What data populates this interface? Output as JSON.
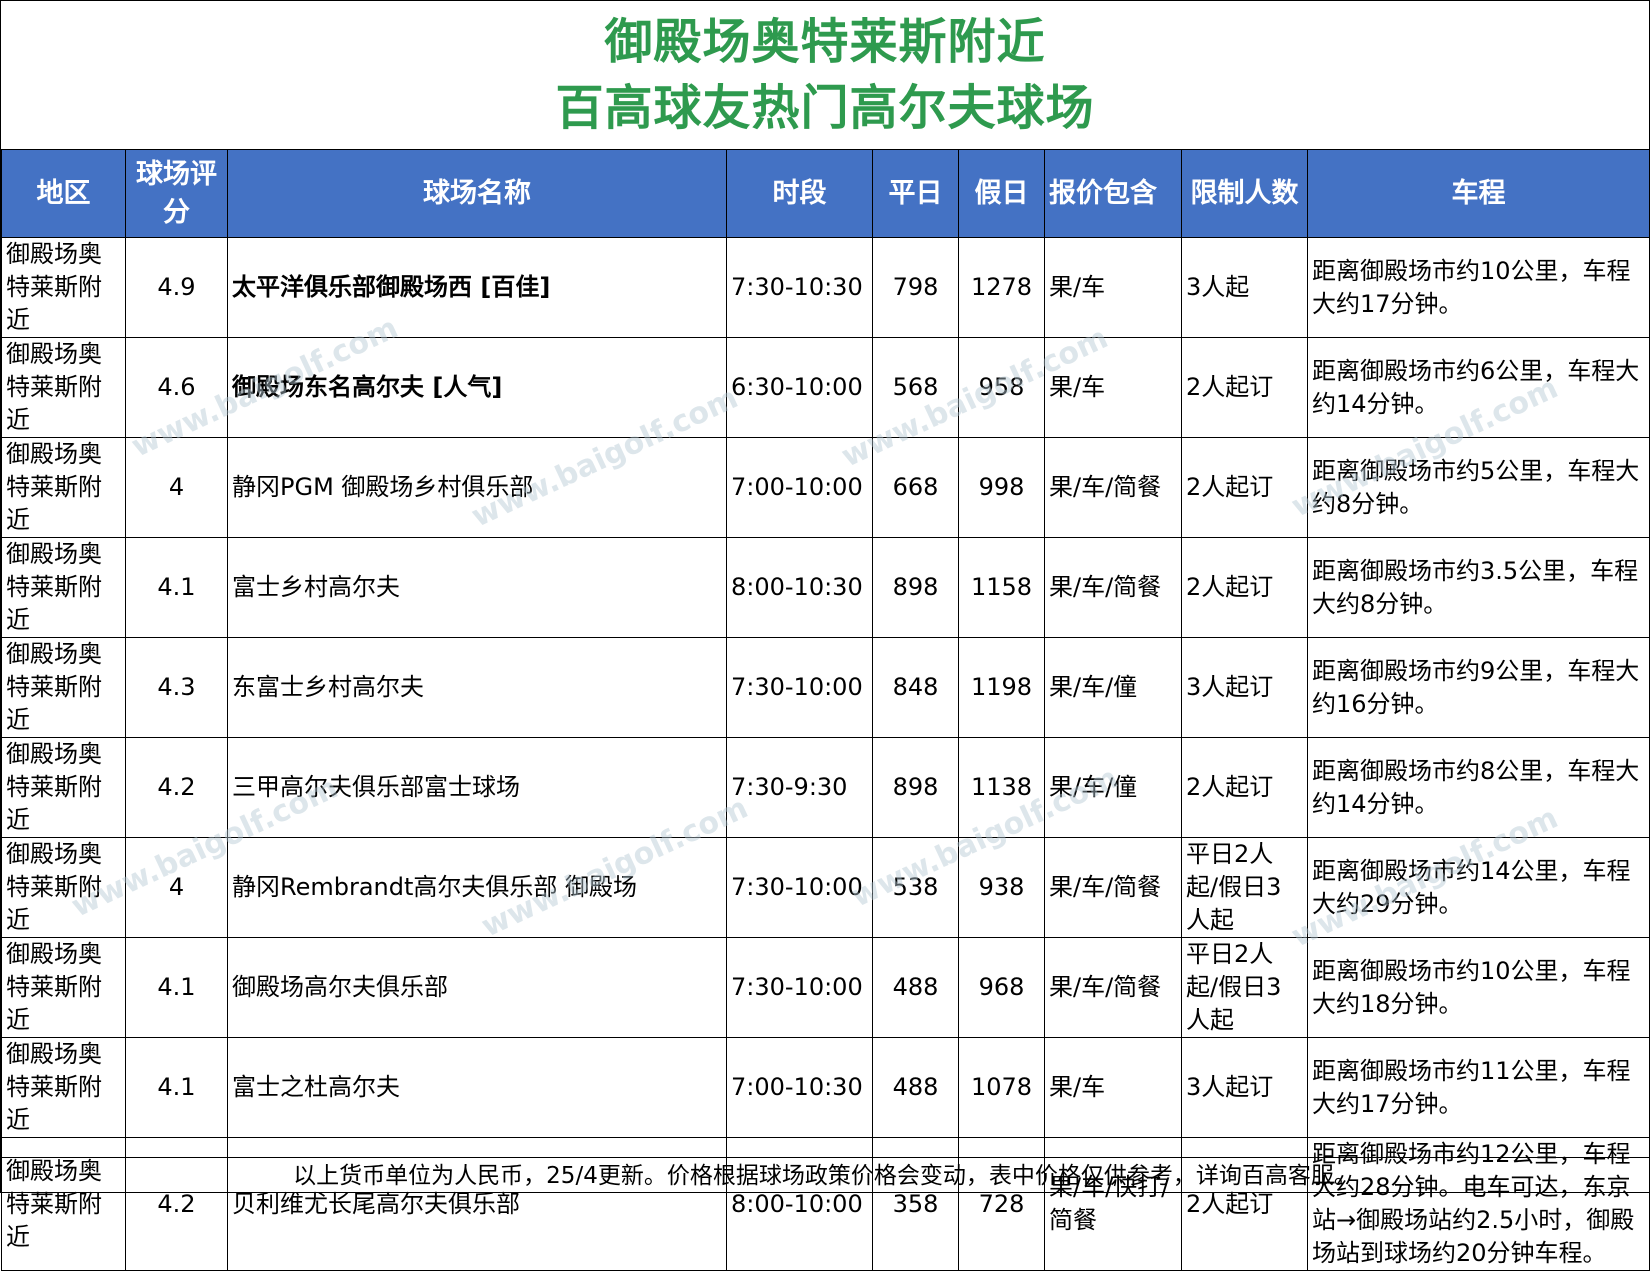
{
  "title": {
    "line1": "御殿场奥特莱斯附近",
    "line2": "百高球友热门高尔夫球场"
  },
  "headers": {
    "region": "地区",
    "rating": "球场评分",
    "name": "球场名称",
    "time": "时段",
    "weekday": "平日",
    "holiday": "假日",
    "includes": "报价包含",
    "limit": "限制人数",
    "drive": "车程"
  },
  "rows": [
    {
      "region": "御殿场奥特莱斯附近",
      "rating": "4.9",
      "name": "太平洋俱乐部御殿场西 [百佳]",
      "bold": true,
      "time": "7:30-10:30",
      "weekday": "798",
      "holiday": "1278",
      "includes": "果/车",
      "limit": "3人起",
      "drive": "距离御殿场市约10公里，车程大约17分钟。"
    },
    {
      "region": "御殿场奥特莱斯附近",
      "rating": "4.6",
      "name": "御殿场东名高尔夫 [人气]",
      "bold": true,
      "time": "6:30-10:00",
      "weekday": "568",
      "holiday": "958",
      "includes": "果/车",
      "limit": "2人起订",
      "drive": "距离御殿场市约6公里，车程大约14分钟。"
    },
    {
      "region": "御殿场奥特莱斯附近",
      "rating": "4",
      "name": "静冈PGM 御殿场乡村俱乐部",
      "bold": false,
      "time": "7:00-10:00",
      "weekday": "668",
      "holiday": "998",
      "includes": "果/车/简餐",
      "limit": "2人起订",
      "drive": "距离御殿场市约5公里，车程大约8分钟。"
    },
    {
      "region": "御殿场奥特莱斯附近",
      "rating": "4.1",
      "name": "富士乡村高尔夫",
      "bold": false,
      "time": "8:00-10:30",
      "weekday": "898",
      "holiday": "1158",
      "includes": "果/车/简餐",
      "limit": "2人起订",
      "drive": "距离御殿场市约3.5公里，车程大约8分钟。"
    },
    {
      "region": "御殿场奥特莱斯附近",
      "rating": "4.3",
      "name": "东富士乡村高尔夫",
      "bold": false,
      "time": "7:30-10:00",
      "weekday": "848",
      "holiday": "1198",
      "includes": "果/车/僮",
      "limit": "3人起订",
      "drive": "距离御殿场市约9公里，车程大约16分钟。"
    },
    {
      "region": "御殿场奥特莱斯附近",
      "rating": "4.2",
      "name": "三甲高尔夫俱乐部富士球场",
      "bold": false,
      "time": "7:30-9:30",
      "weekday": "898",
      "holiday": "1138",
      "includes": "果/车/僮",
      "limit": "2人起订",
      "drive": "距离御殿场市约8公里，车程大约14分钟。"
    },
    {
      "region": "御殿场奥特莱斯附近",
      "rating": "4",
      "name": "静冈Rembrandt高尔夫俱乐部 御殿场",
      "bold": false,
      "time": "7:30-10:00",
      "weekday": "538",
      "holiday": "938",
      "includes": "果/车/简餐",
      "limit": "平日2人起/假日3人起",
      "drive": "距离御殿场市约14公里，车程大约29分钟。"
    },
    {
      "region": "御殿场奥特莱斯附近",
      "rating": "4.1",
      "name": "御殿场高尔夫俱乐部",
      "bold": false,
      "time": "7:30-10:00",
      "weekday": "488",
      "holiday": "968",
      "includes": "果/车/简餐",
      "limit": "平日2人起/假日3人起",
      "drive": "距离御殿场市约10公里，车程大约18分钟。"
    },
    {
      "region": "御殿场奥特莱斯附近",
      "rating": "4.1",
      "name": "富士之杜高尔夫",
      "bold": false,
      "time": "7:00-10:30",
      "weekday": "488",
      "holiday": "1078",
      "includes": "果/车",
      "limit": "3人起订",
      "drive": "距离御殿场市约11公里，车程大约17分钟。"
    },
    {
      "region": "御殿场奥特莱斯附近",
      "rating": "4.2",
      "name": "贝利维尤长尾高尔夫俱乐部",
      "bold": false,
      "time": "8:00-10:00",
      "weekday": "358",
      "holiday": "728",
      "includes": "果/车/快打/简餐",
      "limit": "2人起订",
      "drive": "距离御殿场市约12公里，车程大约28分钟。电车可达，东京站→御殿场站约2.5小时，御殿场站到球场约20分钟车程。"
    }
  ],
  "footer": "以上货币单位为人民币，25/4更新。价格根据球场政策价格会变动，表中价格仅供参考，详询百高客服。",
  "watermark": "www.baigolf.com",
  "colors": {
    "title_green": "#2e9a4e",
    "header_blue": "#4472c4"
  }
}
